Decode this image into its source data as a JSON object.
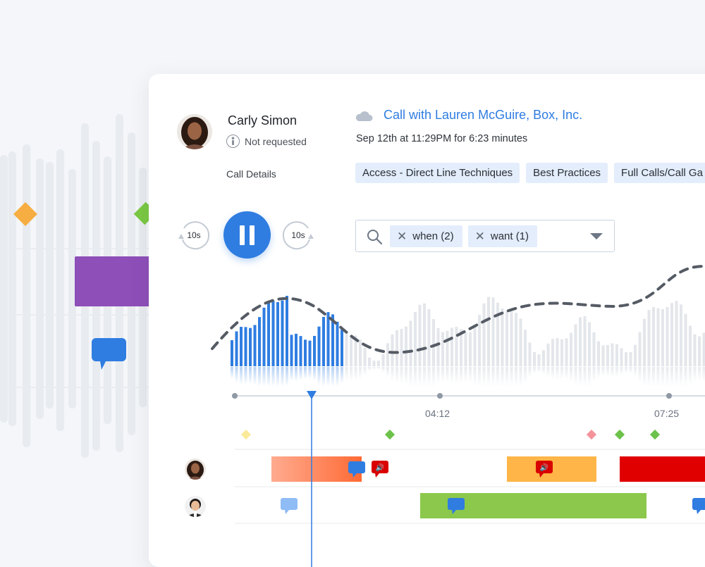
{
  "rep": {
    "name": "Carly Simon",
    "status": "Not requested",
    "details_label": "Call Details"
  },
  "call": {
    "title": "Call with Lauren McGuire, Box, Inc.",
    "date": "Sep 12th at 11:29PM for 6:23 minutes",
    "tags": [
      "Access - Direct Line Techniques",
      "Best Practices",
      "Full Calls/Call Ga"
    ]
  },
  "player": {
    "skip_back_label": "10s",
    "skip_forward_label": "10s",
    "state": "playing",
    "progress": 0.06
  },
  "filter": {
    "chips": [
      {
        "label": "when (2)"
      },
      {
        "label": "want (1)"
      }
    ]
  },
  "timeline": {
    "ticks": [
      "04:12",
      "07:25"
    ]
  },
  "colors": {
    "accent": "#2f7de1",
    "tag_bg": "#e3edfb",
    "orange_segment": "#ff7a45",
    "yellow_segment": "#ffb547",
    "red_segment": "#e00000",
    "green_segment": "#8cc84b",
    "purple_block": "#8e4fb8"
  },
  "icons": [
    "cloud-icon",
    "not-requested-icon",
    "skip-back-icon",
    "pause-icon",
    "skip-forward-icon",
    "search-icon",
    "chevron-down-icon",
    "comment-icon",
    "speaker-icon"
  ]
}
